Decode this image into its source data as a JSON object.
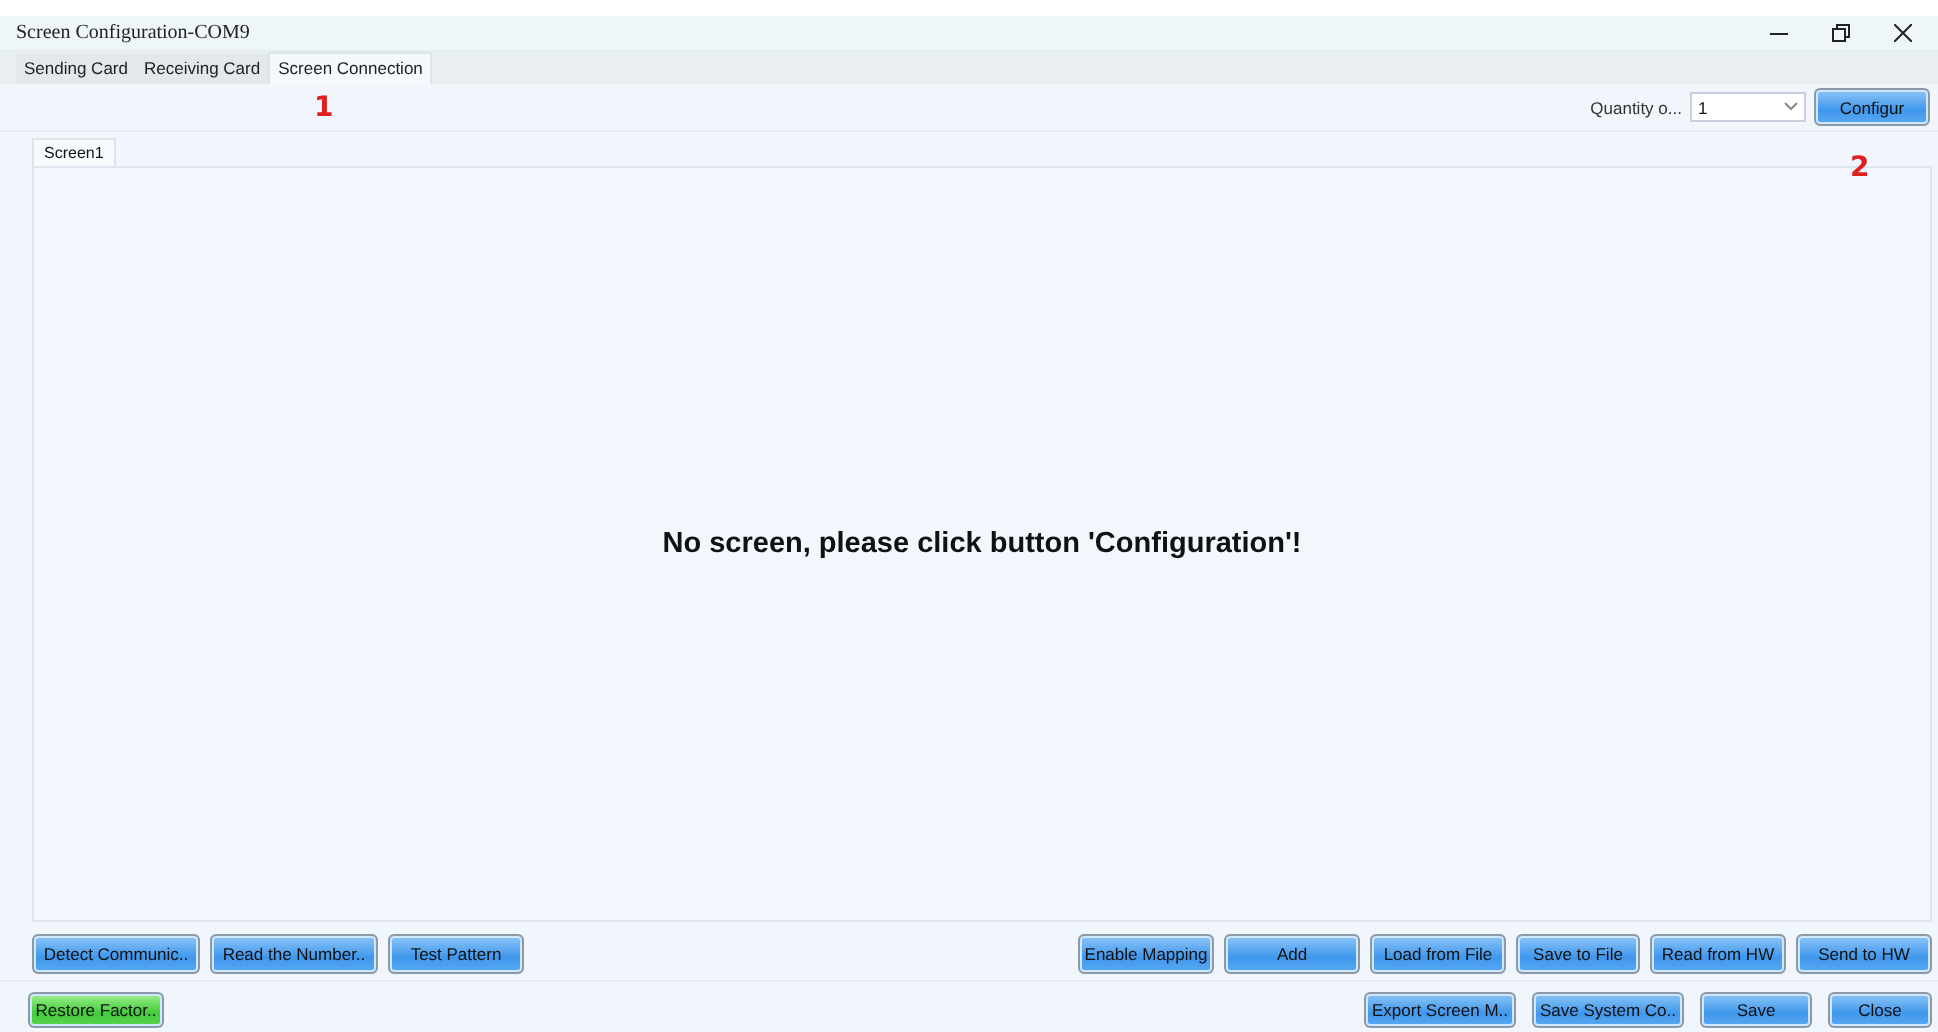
{
  "window": {
    "title": "Screen Configuration-COM9"
  },
  "tabs": [
    {
      "label": "Sending Card",
      "selected": false
    },
    {
      "label": "Receiving Card",
      "selected": false
    },
    {
      "label": "Screen Connection",
      "selected": true
    }
  ],
  "annotations": [
    "1",
    "2"
  ],
  "quantity": {
    "label": "Quantity o...",
    "value": "1"
  },
  "configure_button": "Configur",
  "screen_tabs": [
    {
      "label": "Screen1",
      "selected": true
    }
  ],
  "message": "No screen, please click button 'Configuration'!",
  "left_buttons": [
    {
      "label": "Detect Communic.."
    },
    {
      "label": "Read the Number.."
    },
    {
      "label": "Test Pattern"
    }
  ],
  "right_buttons": [
    {
      "label": "Enable Mapping"
    },
    {
      "label": "Add"
    },
    {
      "label": "Load from File"
    },
    {
      "label": "Save to File"
    },
    {
      "label": "Read from HW"
    },
    {
      "label": "Send to HW"
    }
  ],
  "bottom_buttons": [
    {
      "label": "Restore Factor..",
      "kind": "green"
    },
    {
      "label": "Export Screen M..",
      "kind": "blue"
    },
    {
      "label": "Save System Co..",
      "kind": "blue"
    },
    {
      "label": "Save",
      "kind": "blue"
    },
    {
      "label": "Close",
      "kind": "blue"
    }
  ]
}
